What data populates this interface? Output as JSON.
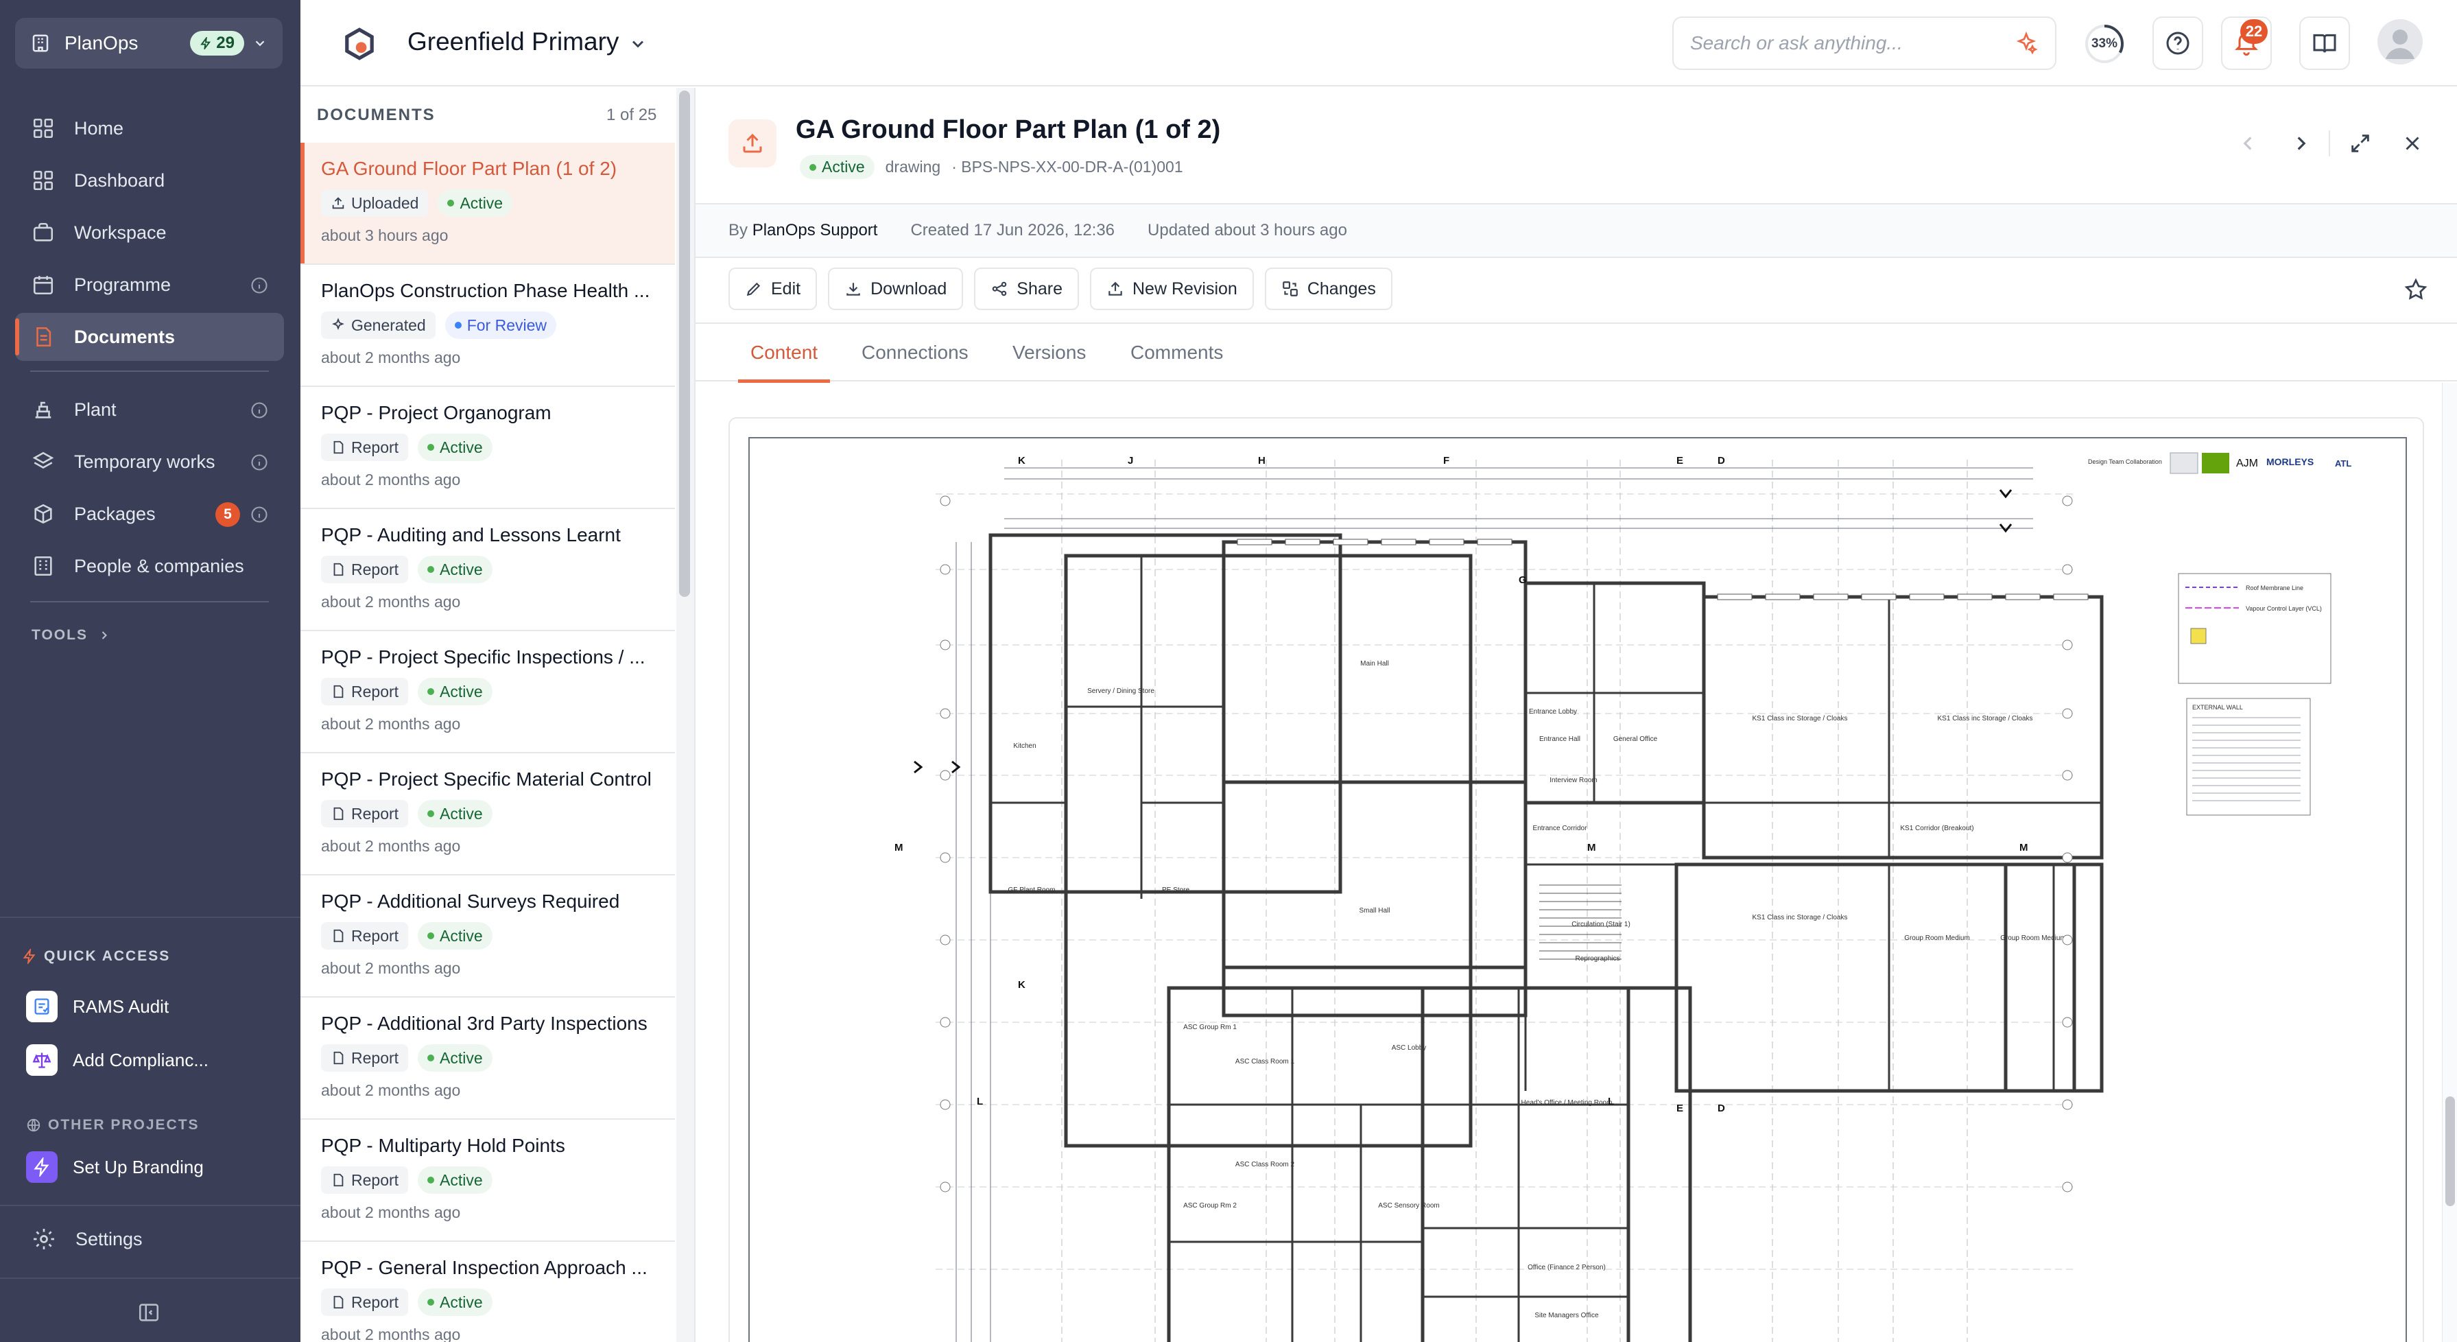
{
  "sidebar": {
    "org_name": "PlanOps",
    "credits": "29",
    "nav": [
      {
        "label": "Home",
        "icon": "grid-icon"
      },
      {
        "label": "Dashboard",
        "icon": "grid-icon"
      },
      {
        "label": "Workspace",
        "icon": "briefcase-icon"
      },
      {
        "label": "Programme",
        "icon": "calendar-icon"
      },
      {
        "label": "Documents",
        "icon": "document-icon"
      },
      {
        "label": "Plant",
        "icon": "plant-icon"
      },
      {
        "label": "Temporary works",
        "icon": "layers-icon"
      },
      {
        "label": "Packages",
        "icon": "package-icon",
        "badge": "5"
      },
      {
        "label": "People & companies",
        "icon": "building-icon"
      }
    ],
    "tools_label": "TOOLS",
    "quick_access_label": "QUICK ACCESS",
    "quick_access": [
      {
        "label": "RAMS Audit"
      },
      {
        "label": "Add Complianc..."
      }
    ],
    "other_projects_label": "OTHER PROJECTS",
    "other_projects": [
      {
        "label": "Set Up Branding"
      }
    ],
    "settings_label": "Settings"
  },
  "topbar": {
    "project_name": "Greenfield Primary",
    "search_placeholder": "Search or ask anything...",
    "progress_label": "33%",
    "progress_value": 0.33,
    "notification_count": "22"
  },
  "doclist": {
    "header": "DOCUMENTS",
    "count": "1 of 25",
    "items": [
      {
        "title": "GA Ground Floor Part Plan (1 of 2)",
        "type": "Uploaded",
        "status": "Active",
        "time": "about 3 hours ago"
      },
      {
        "title": "PlanOps Construction Phase Health ...",
        "type": "Generated",
        "status": "For Review",
        "time": "about 2 months ago"
      },
      {
        "title": "PQP - Project Organogram",
        "type": "Report",
        "status": "Active",
        "time": "about 2 months ago"
      },
      {
        "title": "PQP - Auditing and Lessons Learnt",
        "type": "Report",
        "status": "Active",
        "time": "about 2 months ago"
      },
      {
        "title": "PQP - Project Specific Inspections / ...",
        "type": "Report",
        "status": "Active",
        "time": "about 2 months ago"
      },
      {
        "title": "PQP - Project Specific Material Control",
        "type": "Report",
        "status": "Active",
        "time": "about 2 months ago"
      },
      {
        "title": "PQP - Additional Surveys Required",
        "type": "Report",
        "status": "Active",
        "time": "about 2 months ago"
      },
      {
        "title": "PQP - Additional 3rd Party Inspections",
        "type": "Report",
        "status": "Active",
        "time": "about 2 months ago"
      },
      {
        "title": "PQP - Multiparty Hold Points",
        "type": "Report",
        "status": "Active",
        "time": "about 2 months ago"
      },
      {
        "title": "PQP - General Inspection Approach ...",
        "type": "Report",
        "status": "Active",
        "time": "about 2 months ago"
      }
    ]
  },
  "detail": {
    "title": "GA Ground Floor Part Plan (1 of 2)",
    "status": "Active",
    "kind": "drawing",
    "reference": "· BPS-NPS-XX-00-DR-A-(01)001",
    "by_prefix": "By",
    "author": "PlanOps Support",
    "created": "Created 17 Jun 2026, 12:36",
    "updated": "Updated about 3 hours ago",
    "actions": {
      "edit": "Edit",
      "download": "Download",
      "share": "Share",
      "new_revision": "New Revision",
      "changes": "Changes"
    },
    "tabs": [
      "Content",
      "Connections",
      "Versions",
      "Comments"
    ]
  },
  "drawing": {
    "grid_top": [
      "K",
      "J",
      "H",
      "F",
      "E",
      "D"
    ],
    "grid_mid": [
      "G",
      "M",
      "M",
      "M"
    ],
    "grid_bottom": [
      "K",
      "L",
      "E",
      "D",
      "L"
    ],
    "rooms": [
      "Kitchen",
      "Servery / Dining Store",
      "Main Hall",
      "Entrance Lobby",
      "Entrance Hall",
      "General Office",
      "Interview Room",
      "KS1 Class inc Storage / Cloaks",
      "KS1 Class inc Storage / Cloaks",
      "Entrance Corridor",
      "KS1 Corridor (Breakout)",
      "GF Plant Room",
      "PE Store",
      "Small Hall",
      "Circulation (Stair 1)",
      "Reprographics",
      "KS1 Class inc Storage / Cloaks",
      "Group Room Medium",
      "Group Room Medium",
      "ASC Group Rm 1",
      "ASC Class Room 1",
      "ASC Lobby",
      "Head's Office / Meeting Room",
      "ASC Class Room 2",
      "ASC Group Rm 2",
      "ASC Sensory Room",
      "Office (Finance 2 Person)",
      "Site Managers Office"
    ],
    "legend": [
      "Roof Membrane Line",
      "Vapour Control Layer (VCL)",
      "EXTERNAL WALL"
    ],
    "logos": [
      "AJM",
      "MORLEYS",
      "ATL"
    ],
    "collab_label": "Design Team Collaboration"
  }
}
